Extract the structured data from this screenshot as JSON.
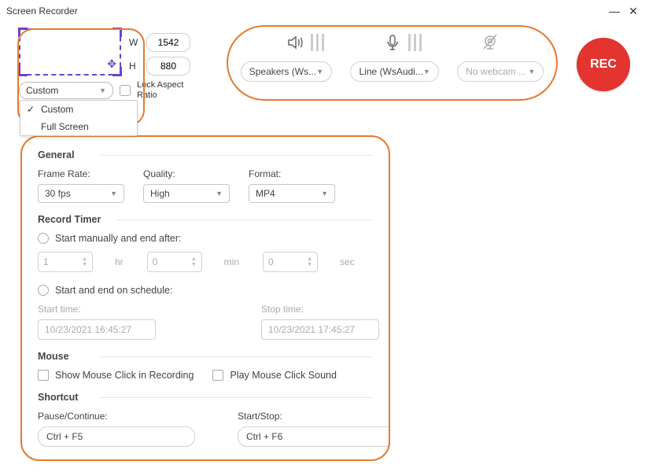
{
  "titlebar": {
    "title": "Screen Recorder",
    "minimize": "—",
    "close": "✕"
  },
  "region": {
    "width_label": "W",
    "width_value": "1542",
    "height_label": "H",
    "height_value": "880",
    "preset_selected": "Custom",
    "lock_label": "Lock Aspect Ratio",
    "dropdown": {
      "custom": "Custom",
      "fullscreen": "Full Screen"
    }
  },
  "devices": {
    "speaker_icon": "speaker-icon",
    "mic_icon": "mic-icon",
    "webcam_icon": "webcam-icon",
    "speaker_select": "Speakers (Ws...",
    "mic_select": "Line (WsAudi...",
    "webcam_select": "No webcam ..."
  },
  "rec_label": "REC",
  "settings": {
    "general_title": "General",
    "framerate_label": "Frame Rate:",
    "framerate_value": "30 fps",
    "quality_label": "Quality:",
    "quality_value": "High",
    "format_label": "Format:",
    "format_value": "MP4",
    "timer_title": "Record Timer",
    "timer_manual_label": "Start manually and end after:",
    "timer_hr": "1",
    "timer_hr_unit": "hr",
    "timer_min": "0",
    "timer_min_unit": "min",
    "timer_sec": "0",
    "timer_sec_unit": "sec",
    "timer_sched_label": "Start and end on schedule:",
    "start_time_label": "Start time:",
    "start_time_value": "10/23/2021 16:45:27",
    "stop_time_label": "Stop time:",
    "stop_time_value": "10/23/2021 17:45:27",
    "mouse_title": "Mouse",
    "mouse_click_label": "Show Mouse Click in Recording",
    "mouse_sound_label": "Play Mouse Click Sound",
    "shortcut_title": "Shortcut",
    "pause_label": "Pause/Continue:",
    "pause_value": "Ctrl + F5",
    "startstop_label": "Start/Stop:",
    "startstop_value": "Ctrl + F6"
  }
}
